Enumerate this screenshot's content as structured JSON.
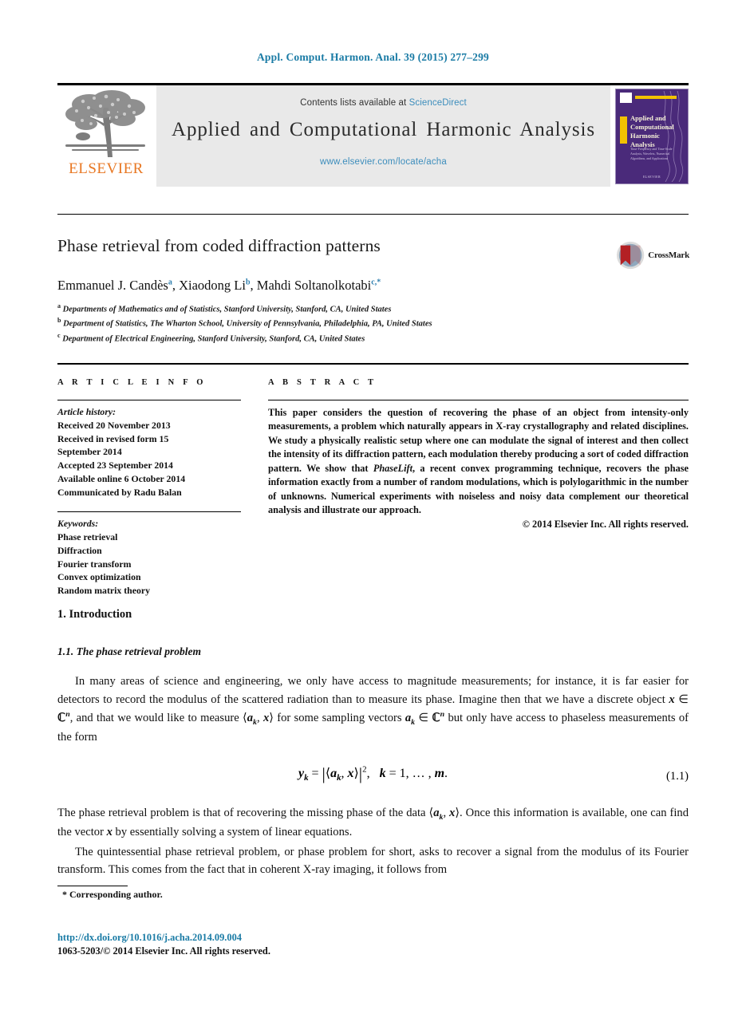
{
  "running_head": "Appl. Comput. Harmon. Anal. 39 (2015) 277–299",
  "masthead": {
    "publisher_logo_label": "ELSEVIER",
    "contents_prefix": "Contents lists available at",
    "sciencedirect_link": "ScienceDirect",
    "journal_title": "Applied and Computational Harmonic Analysis",
    "journal_url": "www.elsevier.com/locate/acha",
    "cover": {
      "title": "Applied and Computational Harmonic Analysis",
      "subtitle": "Time-Frequency and Time-Scale Analysis, Wavelets, Numerical Algorithms, and Applications",
      "bottom_label": "ELSEVIER"
    }
  },
  "article": {
    "title": "Phase retrieval from coded diffraction patterns",
    "crossmark_label": "CrossMark",
    "authors_html": "Emmanuel J. Cand&egrave;s<sup>a</sup>, Xiaodong Li<sup>b</sup>, Mahdi Soltanolkotabi<sup>c,*</sup>",
    "affiliations": [
      {
        "marker": "a",
        "text": "Departments of Mathematics and of Statistics, Stanford University, Stanford, CA, United States"
      },
      {
        "marker": "b",
        "text": "Department of Statistics, The Wharton School, University of Pennsylvania, Philadelphia, PA, United States"
      },
      {
        "marker": "c",
        "text": "Department of Electrical Engineering, Stanford University, Stanford, CA, United States"
      }
    ]
  },
  "info": {
    "heading": "A R T I C L E   I N F O",
    "history_label": "Article history:",
    "history_lines": [
      "Received 20 November 2013",
      "Received in revised form 15",
      "September 2014",
      "Accepted 23 September 2014",
      "Available online 6 October 2014",
      "Communicated by Radu Balan"
    ],
    "keywords_label": "Keywords:",
    "keywords": [
      "Phase retrieval",
      "Diffraction",
      "Fourier transform",
      "Convex optimization",
      "Random matrix theory"
    ]
  },
  "abstract": {
    "heading": "A B S T R A C T",
    "text_part1": "This paper considers the question of recovering the phase of an object from intensity-only measurements, a problem which naturally appears in X-ray crystallography and related disciplines. We study a physically realistic setup where one can modulate the signal of interest and then collect the intensity of its diffraction pattern, each modulation thereby producing a sort of coded diffraction pattern. We show that ",
    "emphasis": "PhaseLift",
    "text_part2": ", a recent convex programming technique, recovers the phase information exactly from a number of random modulations, which is polylogarithmic in the number of unknowns. Numerical experiments with noiseless and noisy data complement our theoretical analysis and illustrate our approach.",
    "copyright": "© 2014 Elsevier Inc. All rights reserved."
  },
  "body": {
    "section_number_title": "1. Introduction",
    "subsection_number_title": "1.1. The phase retrieval problem",
    "paragraph_1_a": "In many areas of science and engineering, we only have access to magnitude measurements; for instance, it is far easier for detectors to record the modulus of the scattered radiation than to measure its phase. Imagine then that we have a discrete object ",
    "paragraph_1_b": ", and that we would like to measure ",
    "paragraph_1_c": " for some sampling vectors ",
    "paragraph_1_d": " but only have access to phaseless measurements of the form",
    "equation_number": "(1.1)",
    "paragraph_2_a": "The phase retrieval problem is that of recovering the missing phase of the data ",
    "paragraph_2_b": ". Once this information is available, one can find the vector ",
    "paragraph_2_c": " by essentially solving a system of linear equations.",
    "paragraph_3": "The quintessential phase retrieval problem, or phase problem for short, asks to recover a signal from the modulus of its Fourier transform. This comes from the fact that in coherent X-ray imaging, it follows from"
  },
  "footer": {
    "corresponding_author": "*  Corresponding author.",
    "doi": "http://dx.doi.org/10.1016/j.acha.2014.09.004",
    "issn_line": "1063-5203/© 2014 Elsevier Inc. All rights reserved."
  },
  "colors": {
    "header_teal": "#1a7ba5",
    "link_blue": "#3c8dbc",
    "elsevier_orange": "#e87722",
    "masthead_gray": "#e9e9e9",
    "cover_purple": "#4a2a7a",
    "cover_yellow": "#f2c200",
    "crossmark_red": "#b32024"
  }
}
